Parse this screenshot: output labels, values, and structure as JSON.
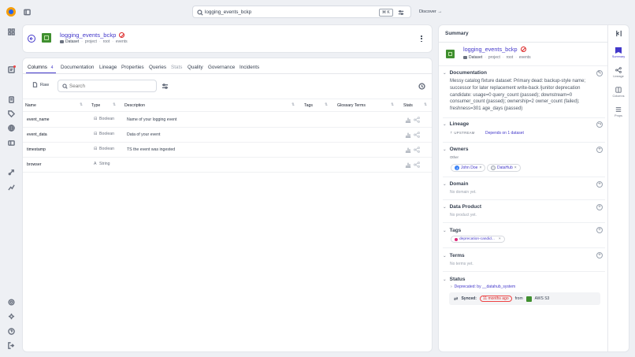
{
  "search": {
    "value": "logging_events_bckp",
    "shortcut": "⌘ K"
  },
  "discover": {
    "label": "Discover"
  },
  "entity": {
    "name": "logging_events_bckp",
    "type": "Dataset",
    "path": [
      "project",
      "root",
      "events"
    ]
  },
  "tabs": [
    {
      "label": "Columns",
      "count": "4"
    },
    {
      "label": "Documentation"
    },
    {
      "label": "Lineage"
    },
    {
      "label": "Properties"
    },
    {
      "label": "Queries"
    },
    {
      "label": "Stats"
    },
    {
      "label": "Quality"
    },
    {
      "label": "Governance"
    },
    {
      "label": "Incidents"
    }
  ],
  "toolbar": {
    "raw_label": "Raw",
    "search_placeholder": "Search"
  },
  "table": {
    "headers": [
      "Name",
      "Type",
      "Description",
      "Tags",
      "Glossary Terms",
      "Stats"
    ],
    "rows": [
      {
        "name": "event_name",
        "type": "Boolean",
        "description": "Name of your logging event"
      },
      {
        "name": "event_data",
        "type": "Boolean",
        "description": "Data of your event"
      },
      {
        "name": "timestamp",
        "type": "Boolean",
        "description": "TS the event was ingested"
      },
      {
        "name": "browser",
        "type": "String",
        "description": ""
      }
    ]
  },
  "summary": {
    "title": "Summary",
    "documentation": {
      "title": "Documentation",
      "text": "Messy catalog fixture dataset: Primary dead: backup-style name; successor for later replacement write-back /junitor deprecation candidate: usage=0 query_count (passed); downstream=0 consumer_count (passed); ownership=2 owner_count (failed); freshness=301 age_days (passed)"
    },
    "lineage": {
      "title": "Lineage",
      "badge": "UPSTREAM",
      "text": "Depends on 1 dataset"
    },
    "owners": {
      "title": "Owners",
      "sub": "Other",
      "items": [
        {
          "name": "John Doe",
          "initial": "J"
        },
        {
          "name": "DataHub",
          "initial": ""
        }
      ]
    },
    "domain": {
      "title": "Domain",
      "empty": "No domain yet."
    },
    "data_product": {
      "title": "Data Product",
      "empty": "No product yet."
    },
    "tags": {
      "title": "Tags",
      "items": [
        "deprecation-candid..."
      ]
    },
    "terms": {
      "title": "Terms",
      "empty": "No terms yet."
    },
    "status": {
      "title": "Status",
      "deprecated": "Deprecated: by __datahub_system",
      "synced_label": "Synced:",
      "synced_ago": "11 months ago",
      "from_label": "from",
      "source": "AWS S3"
    }
  },
  "rail": [
    "Summary",
    "Lineage",
    "Columns",
    "Props"
  ],
  "colors": {
    "accent": "#4338ca",
    "brand_green": "#3f8f2f",
    "deprecated_red": "#dc2626"
  }
}
